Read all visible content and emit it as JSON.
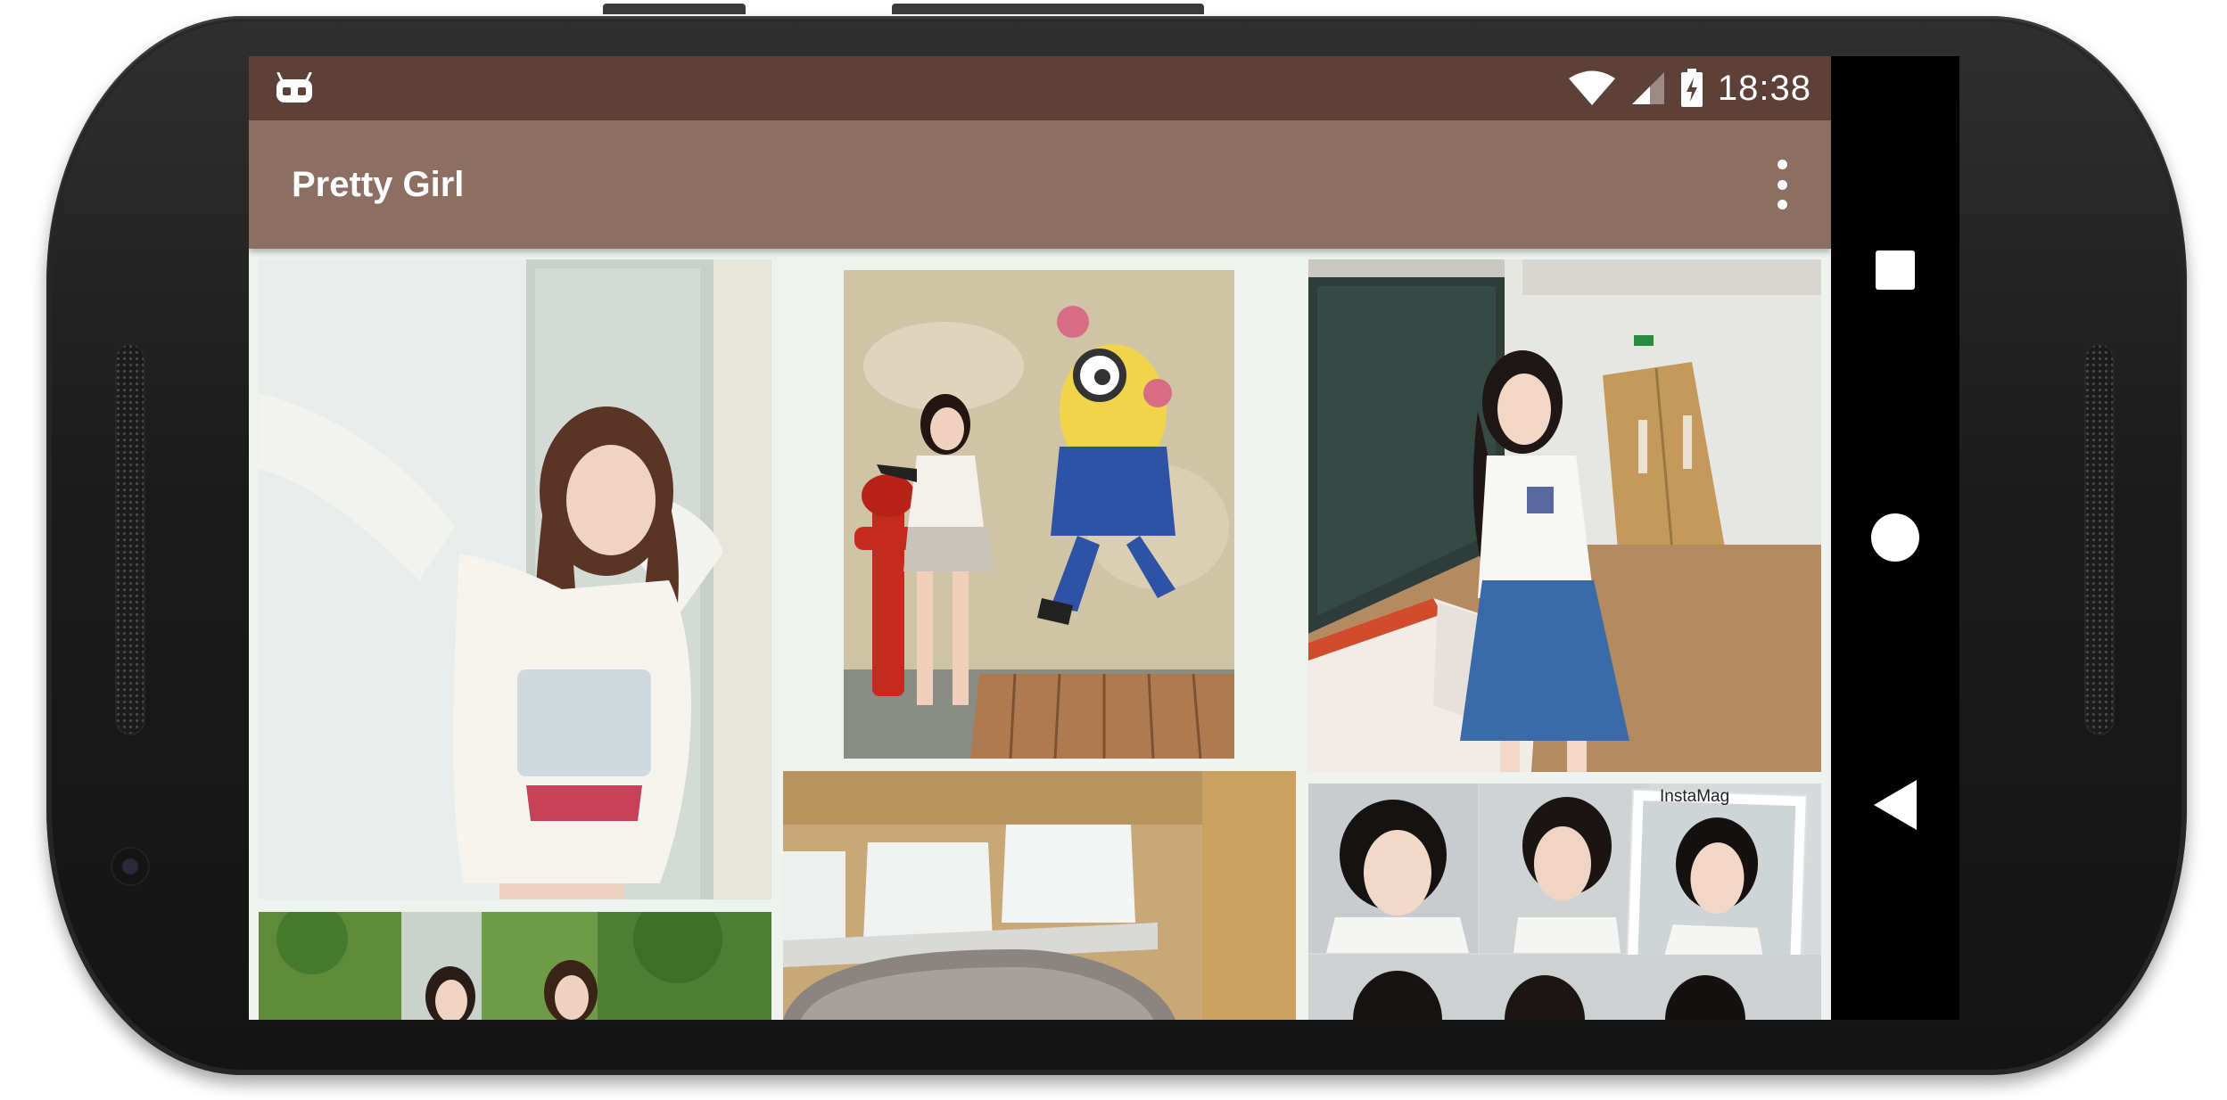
{
  "status_bar": {
    "notification_icon": "android-debug-icon",
    "wifi_icon": "wifi-icon",
    "signal_icon": "cell-signal-icon",
    "battery_icon": "battery-charging-icon",
    "time": "18:38"
  },
  "toolbar": {
    "title": "Pretty Girl",
    "overflow_icon": "more-vert-icon"
  },
  "gallery": {
    "photos": [
      {
        "name": "photo-girl-white-sweater",
        "caption": ""
      },
      {
        "name": "photo-girl-fire-hydrant-minion",
        "caption": ""
      },
      {
        "name": "photo-girl-classroom",
        "caption": ""
      },
      {
        "name": "photo-girls-street",
        "caption": ""
      },
      {
        "name": "photo-white-chairs",
        "caption": ""
      },
      {
        "name": "photo-short-hair-collage",
        "caption": "InstaMag"
      }
    ]
  },
  "nav_bar": {
    "recents_icon": "recents-square-icon",
    "home_icon": "home-circle-icon",
    "back_icon": "back-triangle-icon"
  },
  "colors": {
    "status_bar": "#5d4037",
    "toolbar": "#8d6e63",
    "background": "#eef3ef",
    "nav_bar": "#000000"
  }
}
